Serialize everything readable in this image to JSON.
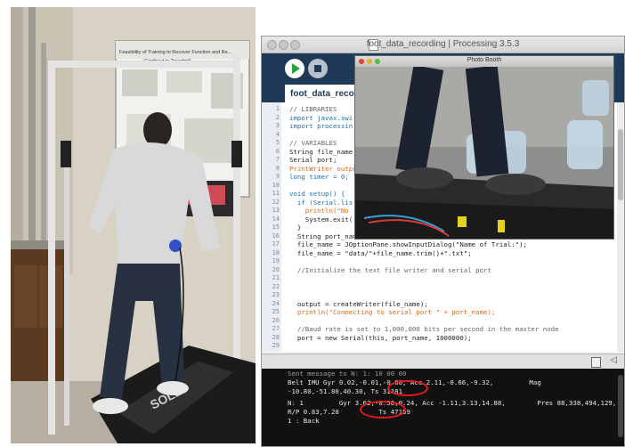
{
  "processing_window": {
    "title": "foot_data_recording | Processing 3.5.3",
    "tab_label": "foot_data_record",
    "line_numbers": [
      "1",
      "2",
      "3",
      "4",
      "5",
      "6",
      "7",
      "8",
      "9",
      "10",
      "11",
      "12",
      "13",
      "14",
      "15",
      "16",
      "17",
      "18",
      "19",
      "20",
      "21",
      "22",
      "23",
      "24",
      "25",
      "26",
      "27",
      "28",
      "29"
    ],
    "code_lines": [
      "// LIBRARIES",
      "import javax.swi",
      "import processin",
      "",
      "// VARIABLES",
      "String file_name",
      "Serial port;",
      "PrintWriter outpu",
      "long timer = 0;",
      "",
      "void setup() {",
      "  if (Serial.lis",
      "    println(\"No",
      "    System.exit(",
      "  }",
      "  String port_nam",
      "  file_name = JOptionPane.showInputDialog(\"Name of Trial:\");",
      "  file_name = \"data/\"+file_name.trim()+\".txt\";",
      "",
      "  //Initialize the text file writer and serial port",
      "",
      "",
      "",
      "  output = createWriter(file_name);",
      "  println(\"Connecting to serial port \" + port_name);",
      "",
      "  //Baud rate is set to 1,000,000 bits per second in the master node",
      "  port = new Serial(this, port_name, 1000000);",
      ""
    ]
  },
  "console": {
    "lines": [
      "Sent message to N: 1: 10 00 00",
      "Belt IMU Gyr 0.02,-0.01,-0.00, Acc 2.11,-0.66,-9.32,         Mag",
      "-10.80,-51.80,40.30, Ts 31181",
      "N: 1         Gyr 3.62,-0.50,0.24, Acc -1.11,3.13,14.88,        Pres 88,338,494,129,",
      "R/P 0.83,7.28          Ts 47159",
      "1 : Back"
    ]
  },
  "photo_booth": {
    "title": "Photo Booth"
  },
  "left_photo": {
    "brand": "SOLE",
    "poster_title": "Feasibility of Training to Recover Function and Re...",
    "poster_subtitle": "Confined to Treadmill"
  }
}
